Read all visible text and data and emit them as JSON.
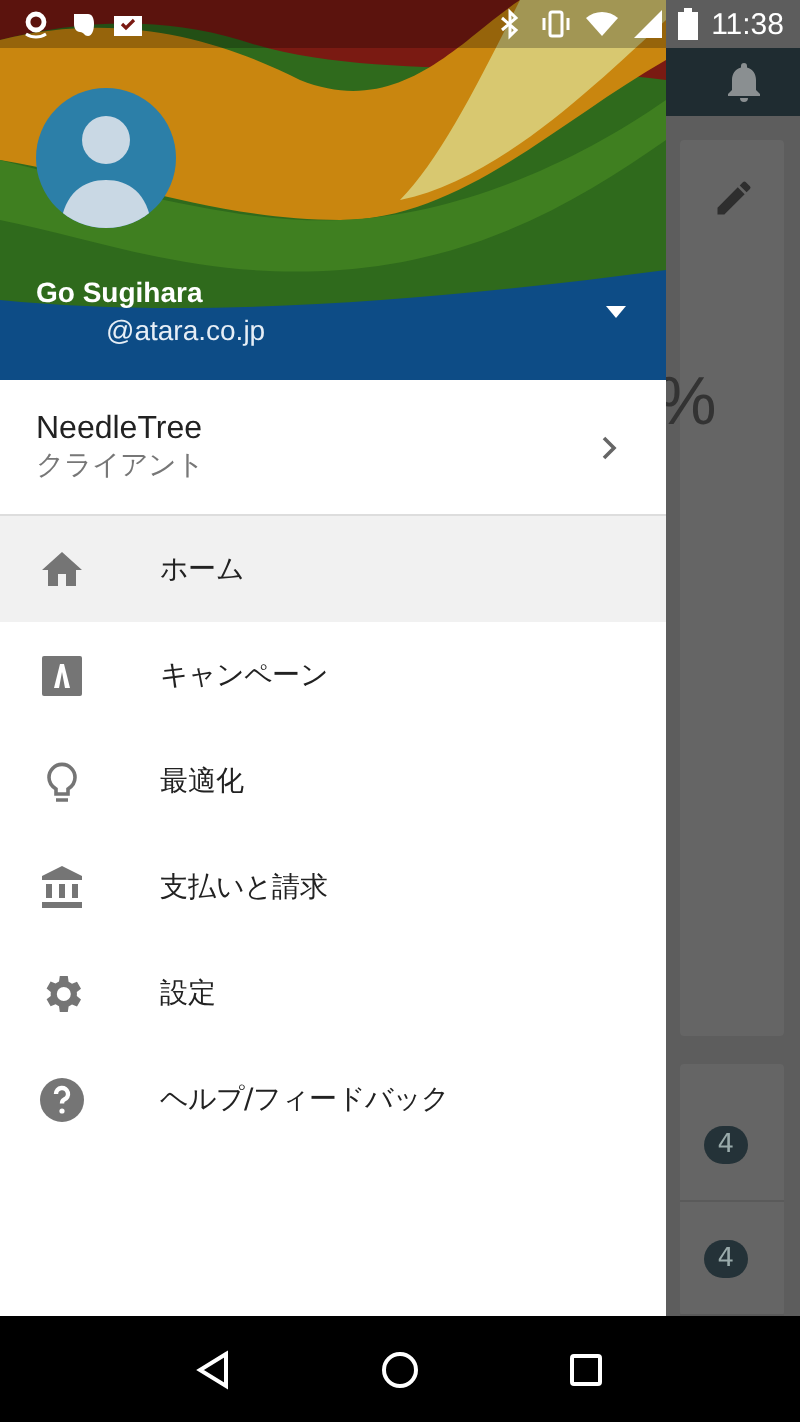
{
  "status_bar": {
    "time": "11:38"
  },
  "account": {
    "name": "Go Sugihara",
    "email": "@atara.co.jp"
  },
  "client": {
    "name": "NeedleTree",
    "role": "クライアント"
  },
  "menu": [
    {
      "kind": "home",
      "label": "ホーム",
      "selected": true
    },
    {
      "kind": "campaign",
      "label": "キャンペーン",
      "selected": false
    },
    {
      "kind": "bulb",
      "label": "最適化",
      "selected": false
    },
    {
      "kind": "bank",
      "label": "支払いと請求",
      "selected": false
    },
    {
      "kind": "gear",
      "label": "設定",
      "selected": false
    },
    {
      "kind": "help",
      "label": "ヘルプ/フィードバック",
      "selected": false
    }
  ],
  "background": {
    "percent_text": "%",
    "badges": [
      "4",
      "4"
    ]
  }
}
